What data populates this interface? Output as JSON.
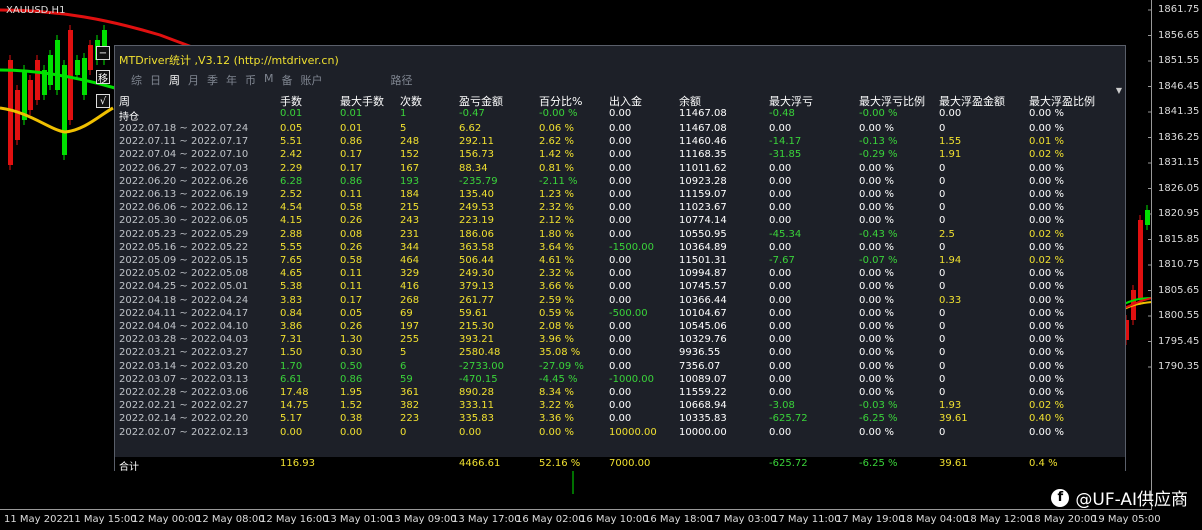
{
  "symbol": "XAUUSD,H1",
  "price_axis": [
    "1861.75",
    "1856.65",
    "1851.55",
    "1846.45",
    "1841.35",
    "1836.25",
    "1831.15",
    "1826.05",
    "1820.95",
    "1815.85",
    "1810.75",
    "1805.65",
    "1800.55",
    "1795.45",
    "1790.35"
  ],
  "time_axis": [
    "11 May 2022",
    "11 May 15:00",
    "12 May 00:00",
    "12 May 08:00",
    "12 May 16:00",
    "13 May 01:00",
    "13 May 09:00",
    "13 May 17:00",
    "16 May 02:00",
    "16 May 10:00",
    "16 May 18:00",
    "17 May 03:00",
    "17 May 11:00",
    "17 May 19:00",
    "18 May 04:00",
    "18 May 12:00",
    "18 May 20:00",
    "19 May 05:00"
  ],
  "side_controls": [
    "−",
    "√",
    "移"
  ],
  "watermark": "@UF-AI供应商",
  "colors": {
    "up": "#00e000",
    "down": "#e01010",
    "yellow": "#f0e030",
    "green": "#3ad33a",
    "white": "#ffffff"
  },
  "panel": {
    "title": "MTDriver统计 ,V3.12 (http://mtdriver.cn)",
    "tabs": [
      "综",
      "日",
      "周",
      "月",
      "季",
      "年",
      "币",
      "M",
      "备",
      "账户"
    ],
    "active_tab": "周",
    "tab_path": "路径",
    "header_row1": "周",
    "header_row2": "持仓",
    "columns": [
      "手数",
      "最大手数",
      "次数",
      "盈亏金额",
      "百分比%",
      "出入金",
      "余额",
      "最大浮亏",
      "最大浮亏比例",
      "最大浮盈金额",
      "最大浮盈比例"
    ],
    "holding": [
      "0.01",
      "0.01",
      "1",
      "-0.47",
      "-0.00 %",
      "0.00",
      "11467.08",
      "-0.48",
      "-0.00 %",
      "0.00",
      "0.00 %"
    ],
    "rows": [
      [
        "2022.07.18 ~ 2022.07.24",
        "0.05",
        "0.01",
        "5",
        "6.62",
        "0.06 %",
        "0.00",
        "11467.08",
        "0.00",
        "0.00 %",
        "0",
        "0.00 %"
      ],
      [
        "2022.07.11 ~ 2022.07.17",
        "5.51",
        "0.86",
        "248",
        "292.11",
        "2.62 %",
        "0.00",
        "11460.46",
        "-14.17",
        "-0.13 %",
        "1.55",
        "0.01 %"
      ],
      [
        "2022.07.04 ~ 2022.07.10",
        "2.42",
        "0.17",
        "152",
        "156.73",
        "1.42 %",
        "0.00",
        "11168.35",
        "-31.85",
        "-0.29 %",
        "1.91",
        "0.02 %"
      ],
      [
        "2022.06.27 ~ 2022.07.03",
        "2.29",
        "0.17",
        "167",
        "88.34",
        "0.81 %",
        "0.00",
        "11011.62",
        "0.00",
        "0.00 %",
        "0",
        "0.00 %"
      ],
      [
        "2022.06.20 ~ 2022.06.26",
        "6.28",
        "0.86",
        "193",
        "-235.79",
        "-2.11 %",
        "0.00",
        "10923.28",
        "0.00",
        "0.00 %",
        "0",
        "0.00 %"
      ],
      [
        "2022.06.13 ~ 2022.06.19",
        "2.52",
        "0.11",
        "184",
        "135.40",
        "1.23 %",
        "0.00",
        "11159.07",
        "0.00",
        "0.00 %",
        "0",
        "0.00 %"
      ],
      [
        "2022.06.06 ~ 2022.06.12",
        "4.54",
        "0.58",
        "215",
        "249.53",
        "2.32 %",
        "0.00",
        "11023.67",
        "0.00",
        "0.00 %",
        "0",
        "0.00 %"
      ],
      [
        "2022.05.30 ~ 2022.06.05",
        "4.15",
        "0.26",
        "243",
        "223.19",
        "2.12 %",
        "0.00",
        "10774.14",
        "0.00",
        "0.00 %",
        "0",
        "0.00 %"
      ],
      [
        "2022.05.23 ~ 2022.05.29",
        "2.88",
        "0.08",
        "231",
        "186.06",
        "1.80 %",
        "0.00",
        "10550.95",
        "-45.34",
        "-0.43 %",
        "2.5",
        "0.02 %"
      ],
      [
        "2022.05.16 ~ 2022.05.22",
        "5.55",
        "0.26",
        "344",
        "363.58",
        "3.64 %",
        "-1500.00",
        "10364.89",
        "0.00",
        "0.00 %",
        "0",
        "0.00 %"
      ],
      [
        "2022.05.09 ~ 2022.05.15",
        "7.65",
        "0.58",
        "464",
        "506.44",
        "4.61 %",
        "0.00",
        "11501.31",
        "-7.67",
        "-0.07 %",
        "1.94",
        "0.02 %"
      ],
      [
        "2022.05.02 ~ 2022.05.08",
        "4.65",
        "0.11",
        "329",
        "249.30",
        "2.32 %",
        "0.00",
        "10994.87",
        "0.00",
        "0.00 %",
        "0",
        "0.00 %"
      ],
      [
        "2022.04.25 ~ 2022.05.01",
        "5.38",
        "0.11",
        "416",
        "379.13",
        "3.66 %",
        "0.00",
        "10745.57",
        "0.00",
        "0.00 %",
        "0",
        "0.00 %"
      ],
      [
        "2022.04.18 ~ 2022.04.24",
        "3.83",
        "0.17",
        "268",
        "261.77",
        "2.59 %",
        "0.00",
        "10366.44",
        "0.00",
        "0.00 %",
        "0.33",
        "0.00 %"
      ],
      [
        "2022.04.11 ~ 2022.04.17",
        "0.84",
        "0.05",
        "69",
        "59.61",
        "0.59 %",
        "-500.00",
        "10104.67",
        "0.00",
        "0.00 %",
        "0",
        "0.00 %"
      ],
      [
        "2022.04.04 ~ 2022.04.10",
        "3.86",
        "0.26",
        "197",
        "215.30",
        "2.08 %",
        "0.00",
        "10545.06",
        "0.00",
        "0.00 %",
        "0",
        "0.00 %"
      ],
      [
        "2022.03.28 ~ 2022.04.03",
        "7.31",
        "1.30",
        "255",
        "393.21",
        "3.96 %",
        "0.00",
        "10329.76",
        "0.00",
        "0.00 %",
        "0",
        "0.00 %"
      ],
      [
        "2022.03.21 ~ 2022.03.27",
        "1.50",
        "0.30",
        "5",
        "2580.48",
        "35.08 %",
        "0.00",
        "9936.55",
        "0.00",
        "0.00 %",
        "0",
        "0.00 %"
      ],
      [
        "2022.03.14 ~ 2022.03.20",
        "1.70",
        "0.50",
        "6",
        "-2733.00",
        "-27.09 %",
        "0.00",
        "7356.07",
        "0.00",
        "0.00 %",
        "0",
        "0.00 %"
      ],
      [
        "2022.03.07 ~ 2022.03.13",
        "6.61",
        "0.86",
        "59",
        "-470.15",
        "-4.45 %",
        "-1000.00",
        "10089.07",
        "0.00",
        "0.00 %",
        "0",
        "0.00 %"
      ],
      [
        "2022.02.28 ~ 2022.03.06",
        "17.48",
        "1.95",
        "361",
        "890.28",
        "8.34 %",
        "0.00",
        "11559.22",
        "0.00",
        "0.00 %",
        "0",
        "0.00 %"
      ],
      [
        "2022.02.21 ~ 2022.02.27",
        "14.75",
        "1.52",
        "382",
        "333.11",
        "3.22 %",
        "0.00",
        "10668.94",
        "-3.08",
        "-0.03 %",
        "1.93",
        "0.02 %"
      ],
      [
        "2022.02.14 ~ 2022.02.20",
        "5.17",
        "0.38",
        "223",
        "335.83",
        "3.36 %",
        "0.00",
        "10335.83",
        "-625.72",
        "-6.25 %",
        "39.61",
        "0.40 %"
      ],
      [
        "2022.02.07 ~ 2022.02.13",
        "0.00",
        "0.00",
        "0",
        "0.00",
        "0.00 %",
        "10000.00",
        "10000.00",
        "0.00",
        "0.00 %",
        "0",
        "0.00 %"
      ]
    ],
    "total": [
      "合计",
      "116.93",
      "",
      "",
      "4466.61",
      "52.16 %",
      "7000.00",
      "",
      "-625.72",
      "-6.25 %",
      "39.61",
      "0.4 %"
    ]
  }
}
